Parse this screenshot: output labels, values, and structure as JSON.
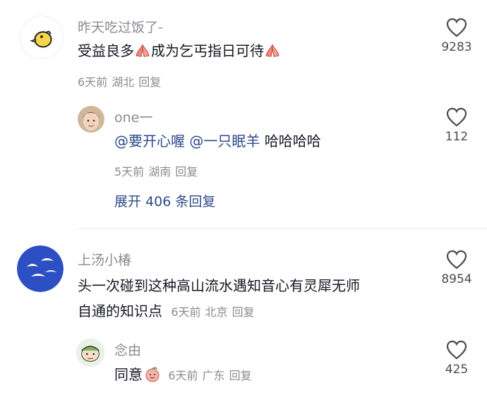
{
  "comments": [
    {
      "username": "昨天吃过饭了-",
      "text_parts": [
        "受益良多",
        "成为乞丐指日可待"
      ],
      "time": "6天前",
      "location": "湖北",
      "reply": "回复",
      "likes": "9283",
      "avatar_icon": "yellow-bird-avatar",
      "emoji_icon": "praying-hands-icon"
    },
    {
      "username": "one一",
      "mention1": "@要开心喔",
      "mention2": "@一只眠羊",
      "text": "哈哈哈哈",
      "time": "5天前",
      "location": "湖南",
      "reply": "回复",
      "likes": "112",
      "avatar_icon": "person-photo-avatar",
      "expand_label": "展开 406 条回复"
    },
    {
      "username": "上汤小椿",
      "text_line1": "头一次碰到这种高山流水遇知音心有灵犀无师",
      "text_line2": "自通的知识点",
      "time": "6天前",
      "location": "北京",
      "reply": "回复",
      "likes": "8954",
      "avatar_icon": "blue-birds-avatar"
    },
    {
      "username": "念由",
      "text": "同意",
      "time": "6天前",
      "location": "广东",
      "reply": "回复",
      "likes": "425",
      "avatar_icon": "cartoon-character-avatar",
      "emoji_icon": "peach-face-icon"
    }
  ],
  "colors": {
    "text": "#161823",
    "muted": "#8a8b91",
    "mention": "#2f4a8a"
  }
}
